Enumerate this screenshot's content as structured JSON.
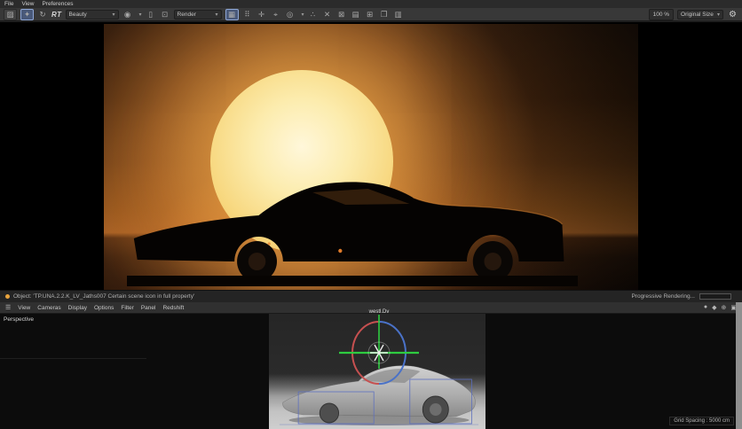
{
  "menu_bar": {
    "items": [
      "File",
      "View",
      "Preferences"
    ]
  },
  "toolbar": {
    "rt_label": "RT",
    "aov_value": "Beauty",
    "render_value": "Render",
    "zoom_value": "100 %",
    "size_value": "Original Size",
    "caret": "▾",
    "icons": {
      "save_image": "▨",
      "snapshot": "✦",
      "restart": "↻",
      "display_mode": "◉",
      "pin": "▯",
      "crop": "⊡",
      "bucket": "▦",
      "grid": "⠿",
      "pan": "✛",
      "probe": "⌖",
      "filter": "◎",
      "dots": "∴",
      "fit": "✕",
      "expand": "⊠",
      "panel_a": "▤",
      "panel_b": "⊞",
      "panel_c": "❐",
      "panel_d": "▥",
      "gear": "⚙"
    }
  },
  "status_bar": {
    "object_message": "Object: 'TP.UNA.2.2.K_LV_Jaths007 Certain scene icon in full property'",
    "progress_label": "Progressive Rendering..."
  },
  "viewport": {
    "menu_items": [
      "View",
      "Cameras",
      "Display",
      "Options",
      "Filter",
      "Panel",
      "Redshift"
    ],
    "hamburger": "☰",
    "view_label": "Perspective",
    "gizmo_label": "westl.Dv",
    "grid_spacing": "Grid Spacing : 5000 cm",
    "icons": {
      "a": "●",
      "b": "◆",
      "c": "⊕",
      "d": "▣"
    }
  },
  "colors": {
    "accent_orange": "#d4691e",
    "sun_core": "#fff7da",
    "gizmo_red": "#c65050",
    "gizmo_blue": "#4a72c8",
    "gizmo_green": "#2ecc40",
    "selection_blue": "#5c6fbf"
  }
}
